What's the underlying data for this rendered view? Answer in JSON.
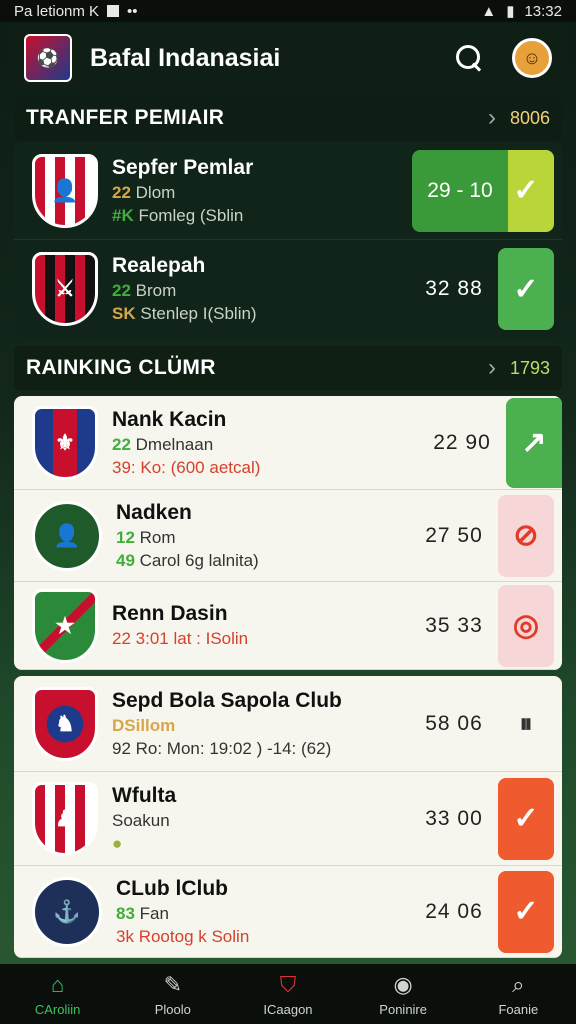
{
  "status": {
    "carrier": "Pa letionm K",
    "time": "13:32"
  },
  "app": {
    "title": "Bafal Indanasiai"
  },
  "sections": [
    {
      "title": "TRANFER PEMIAIR",
      "count": "8006"
    },
    {
      "title": "RAINKING CLÜMR",
      "count": "1793"
    }
  ],
  "transfer_rows": [
    {
      "name": "Sepfer Pemlar",
      "l2_num": "22",
      "l2": "Dlom",
      "l3_num": "#K",
      "l3": "Fomleg (Sblin",
      "score": "29 - 10",
      "action_icon": "✓"
    },
    {
      "name": "Realepah",
      "l2_num": "22",
      "l2": "Brom",
      "l3_num": "SK",
      "l3": "Stenlep I(Sblin)",
      "score": "32  88",
      "action_icon": "✓"
    }
  ],
  "ranking_rows": [
    {
      "name": "Nank Kacin",
      "l2_num": "22",
      "l2": "Dmelnaan",
      "l3_num": "39:",
      "l3": "Ko: (600 aetcal)",
      "score": "22  90",
      "action_icon": "↗"
    },
    {
      "name": "Nadken",
      "l2_num": "12",
      "l2": "Rom",
      "l3_num": "49",
      "l3": "Carol 6g lalnita)",
      "score": "27  50",
      "action_icon": "⊘"
    },
    {
      "name": "Renn Dasin",
      "l2_num": "",
      "l2": "",
      "l3_num": "22",
      "l3": "3:01 lat : ISolin",
      "score": "35  33",
      "action_icon": "◎"
    }
  ],
  "club_rows": [
    {
      "name": "Sepd Bola Sapola Club",
      "l2_num": "",
      "l2": "DSillom",
      "l3_num": "",
      "l3": "92 Ro: Mon: 19:02 ) -14: (62)",
      "score": "58  06",
      "action_icon": "⏸"
    },
    {
      "name": "Wfulta",
      "l2_num": "",
      "l2": "Soakun",
      "l3_num": "",
      "l3": "●",
      "score": "33  00",
      "action_icon": "✓"
    },
    {
      "name": "CLub lClub",
      "l2_num": "83",
      "l2": "Fan",
      "l3_num": "3k",
      "l3": "Rootog k Solin",
      "score": "24  06",
      "action_icon": "✓"
    }
  ],
  "nav": [
    {
      "label": "CAroliin",
      "icon": "home-icon"
    },
    {
      "label": "Ploolo",
      "icon": "edit-icon"
    },
    {
      "label": "ICaagon",
      "icon": "shield-icon"
    },
    {
      "label": "Poninire",
      "icon": "circle-icon"
    },
    {
      "label": "Foanie",
      "icon": "search-icon"
    }
  ]
}
